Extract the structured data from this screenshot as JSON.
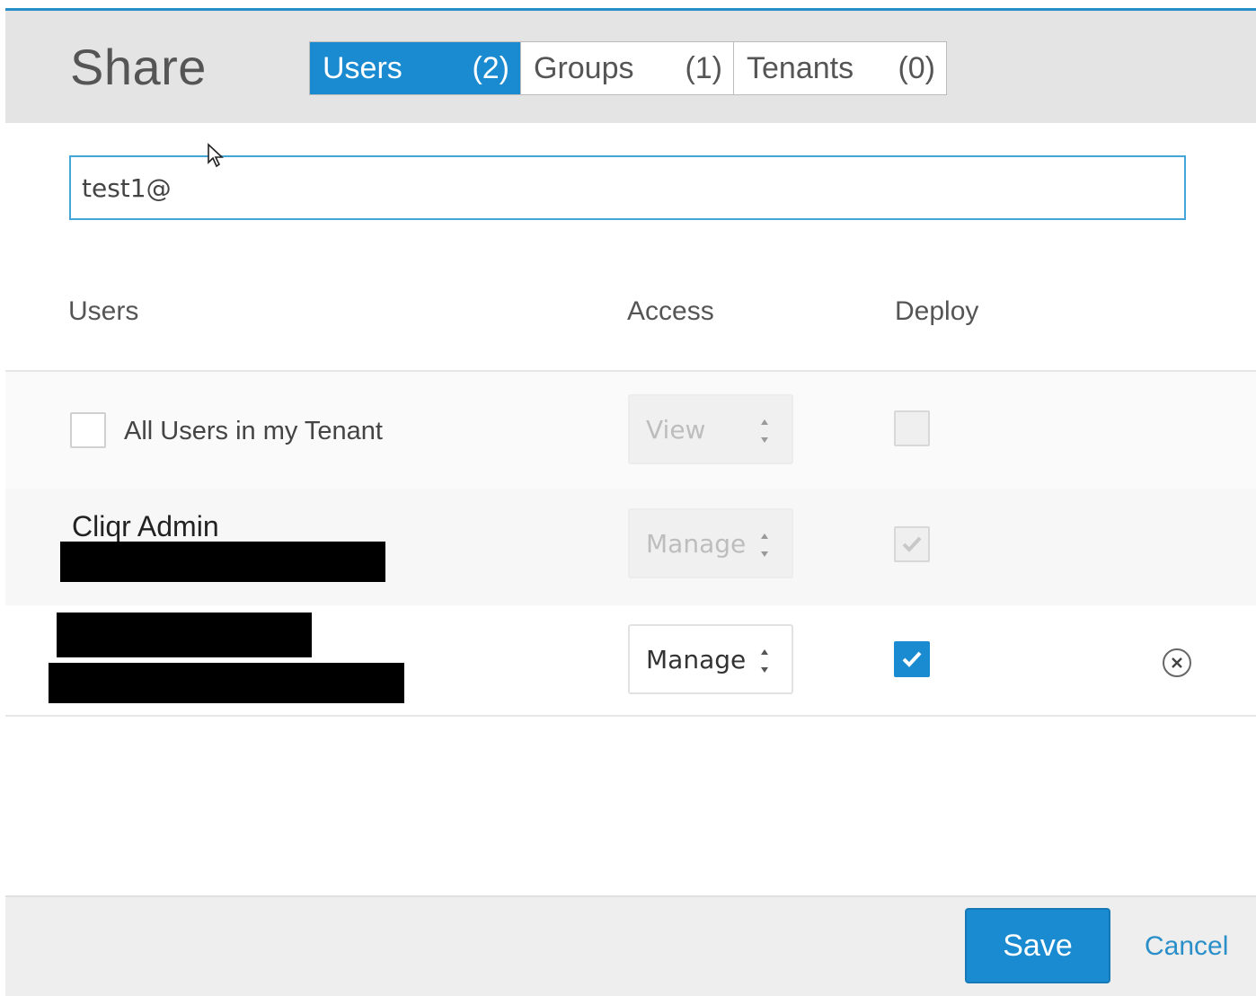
{
  "dialog": {
    "title": "Share",
    "tabs": [
      {
        "label": "Users",
        "count": "(2)",
        "active": true
      },
      {
        "label": "Groups",
        "count": "(1)",
        "active": false
      },
      {
        "label": "Tenants",
        "count": "(0)",
        "active": false
      }
    ]
  },
  "search": {
    "value": "test1@"
  },
  "table": {
    "headers": {
      "users": "Users",
      "access": "Access",
      "deploy": "Deploy"
    },
    "rows": [
      {
        "label": "All Users in my Tenant",
        "access": "View",
        "deploy_checked": false,
        "disabled": true
      },
      {
        "name": "Cliqr Admin",
        "access": "Manage",
        "deploy_checked": true,
        "disabled": true
      },
      {
        "name": "",
        "access": "Manage",
        "deploy_checked": true,
        "disabled": false
      }
    ]
  },
  "footer": {
    "save_label": "Save",
    "cancel_label": "Cancel"
  },
  "colors": {
    "accent": "#1a8bd1",
    "focus": "#44a5d9",
    "header_bg": "#e4e4e4"
  },
  "icons": [
    "cursor-arrow-icon",
    "spinner-arrows-icon",
    "checkmark-icon",
    "remove-circle-icon"
  ]
}
